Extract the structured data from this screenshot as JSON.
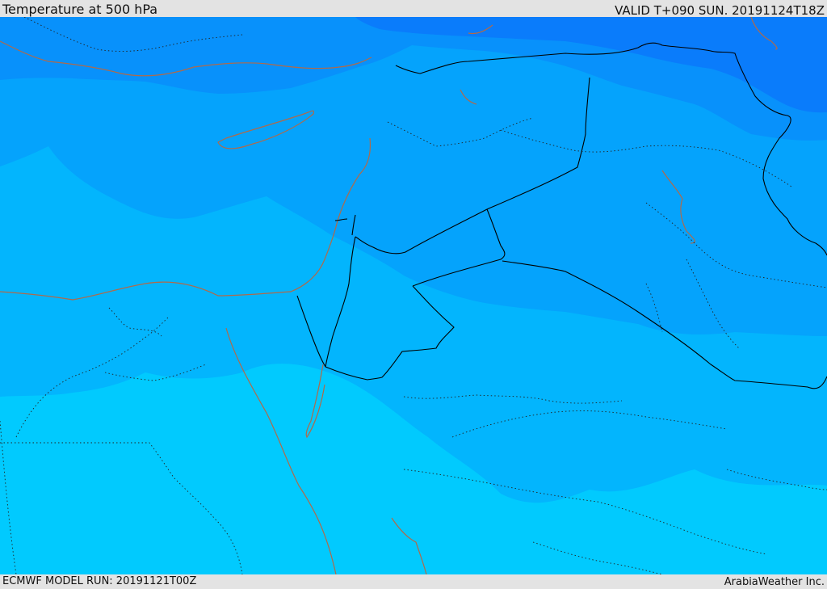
{
  "header": {
    "title": "Temperature at 500 hPa",
    "valid": "VALID T+090 SUN. 20191124T18Z"
  },
  "footer": {
    "model_run": "ECMWF MODEL RUN: 20191121T00Z",
    "credit": "ArabiaWeather Inc."
  },
  "colors": {
    "band_coldest": "#0a7cfb",
    "band_cold": "#0891fb",
    "band_mid": "#05a3fc",
    "band_warm": "#03b5fd",
    "band_warmest": "#01cafe",
    "country_border": "#000000",
    "admin_border": "#222222",
    "coastline": "#b06a4a"
  }
}
